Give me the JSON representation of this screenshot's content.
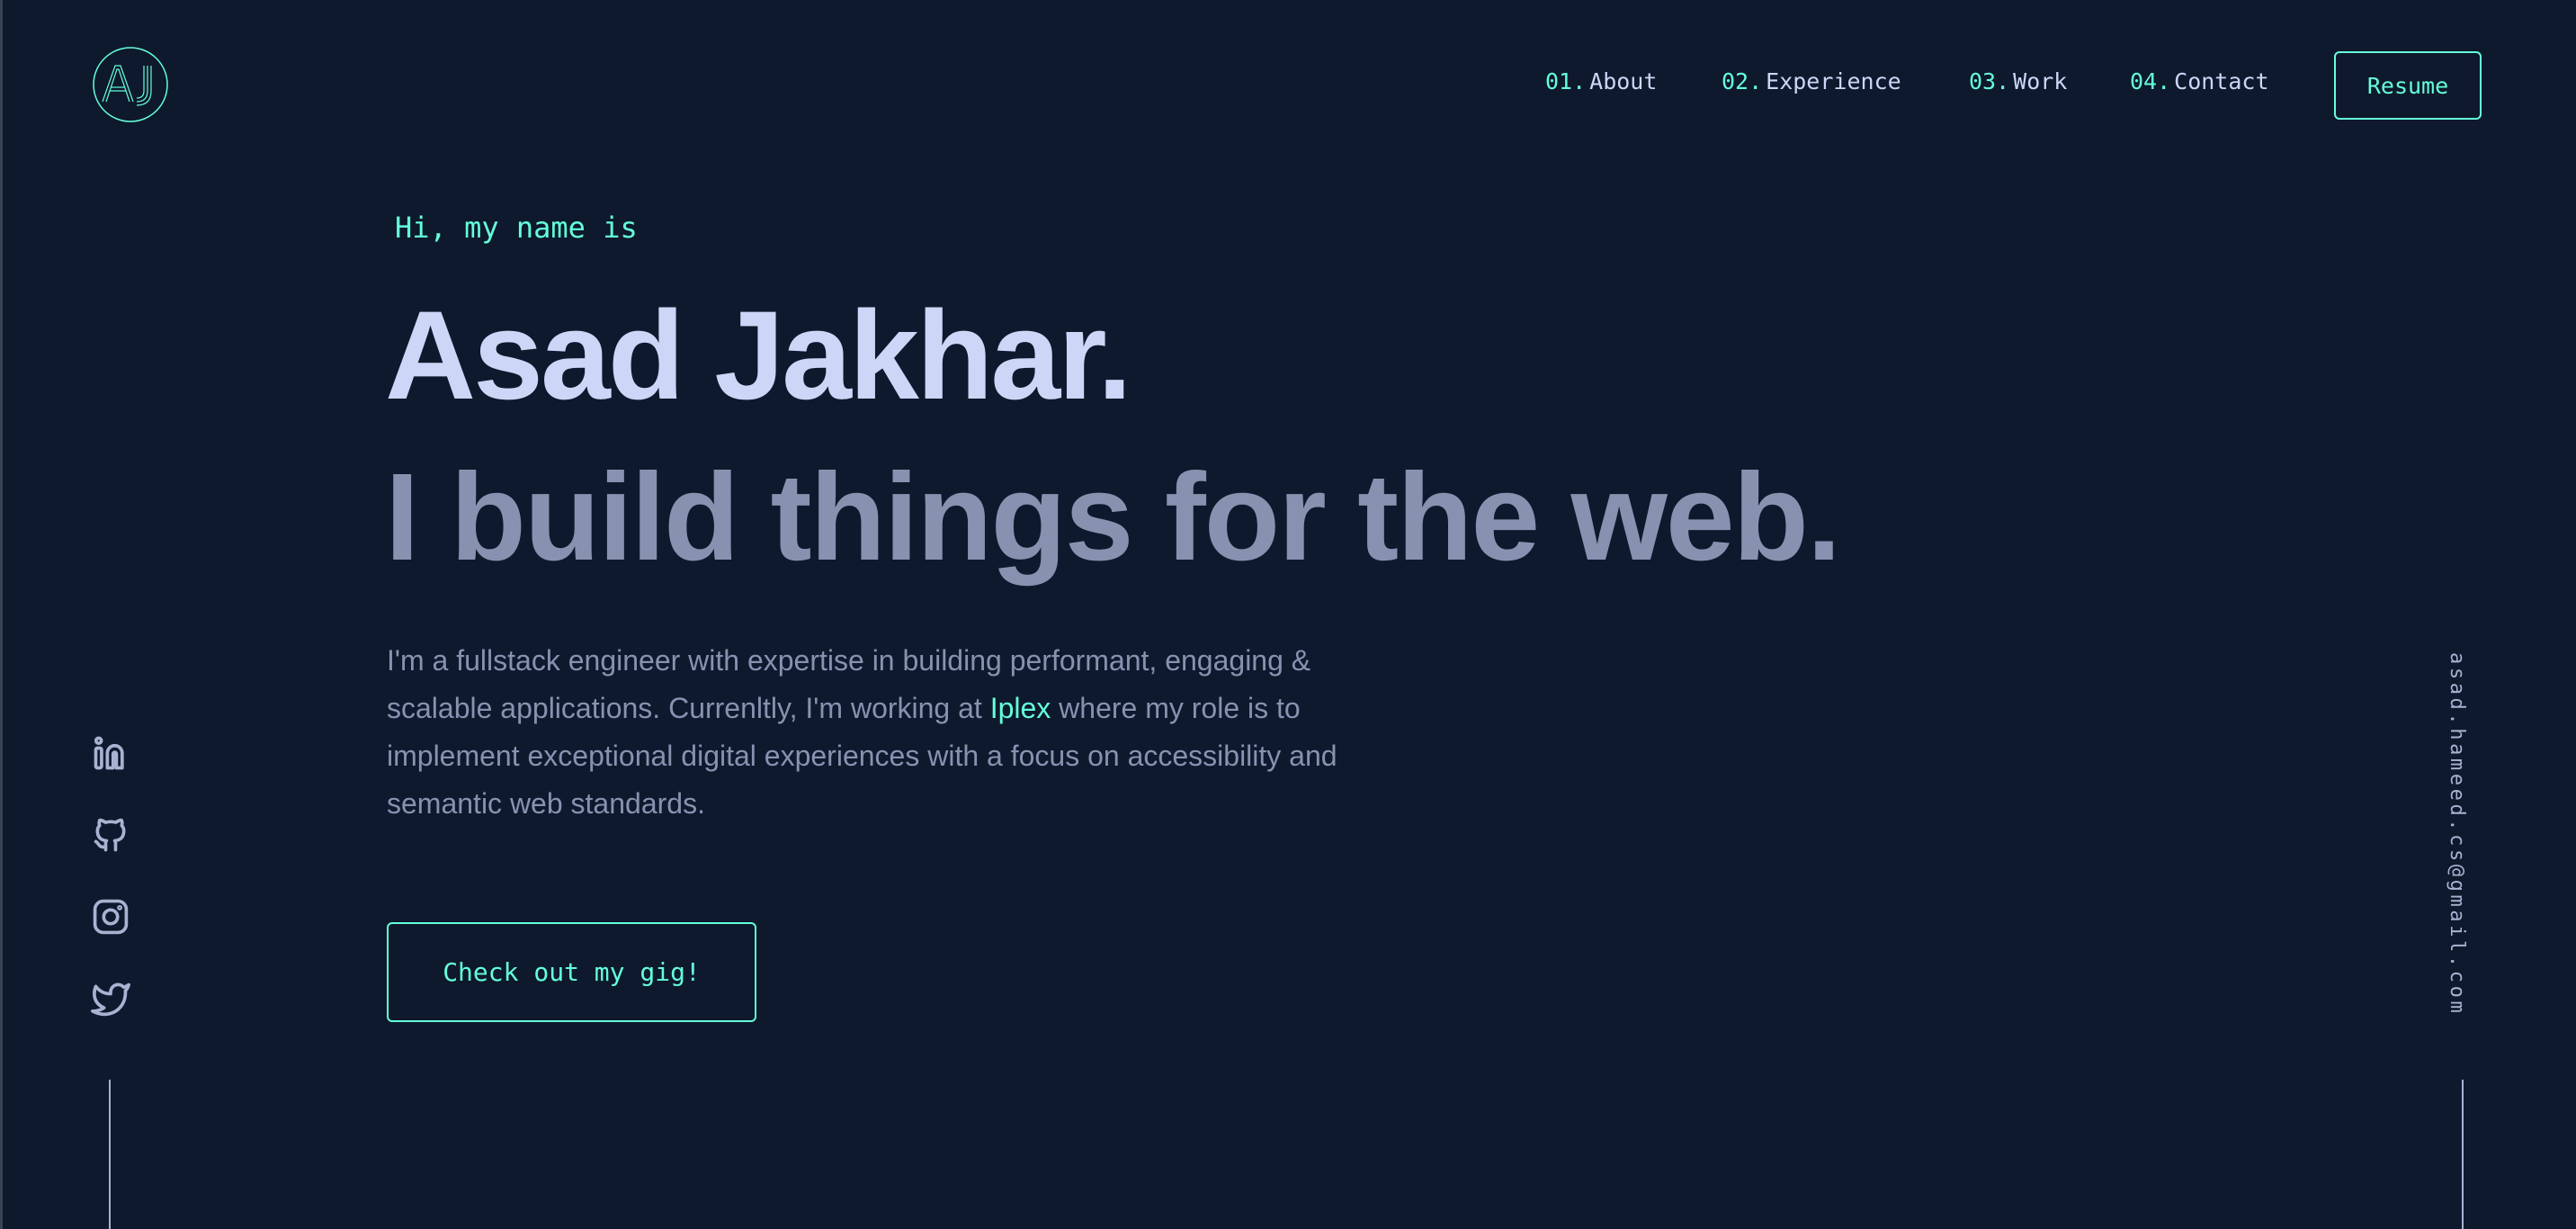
{
  "logo": {
    "text": "AJ"
  },
  "nav": {
    "items": [
      {
        "num": "01.",
        "label": "About"
      },
      {
        "num": "02.",
        "label": "Experience"
      },
      {
        "num": "03.",
        "label": "Work"
      },
      {
        "num": "04.",
        "label": "Contact"
      }
    ],
    "resume": "Resume"
  },
  "hero": {
    "greeting": "Hi, my name is",
    "name": "Asad Jakhar.",
    "tagline": "I build things for the web.",
    "bio_before": "I'm a fullstack engineer with expertise in building performant, engaging & scalable applications. Currenltly, I'm working at ",
    "bio_link": "Iplex",
    "bio_after": " where my role is to implement exceptional digital experiences with a focus on accessibility and semantic web standards.",
    "cta": "Check out my gig!"
  },
  "social": [
    "linkedin-icon",
    "github-icon",
    "instagram-icon",
    "twitter-icon"
  ],
  "email": "asad.hameed.cs@gmail.com",
  "colors": {
    "background": "#0e192d",
    "accent": "#64ffda",
    "heading": "#ccd6f6",
    "muted": "#8892b0"
  }
}
